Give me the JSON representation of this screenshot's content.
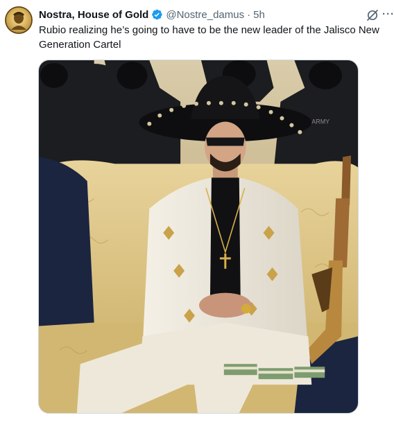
{
  "author": {
    "display_name": "Nostra, House of Gold",
    "handle": "@Nostre_damus",
    "separator": "·",
    "time": "5h",
    "verified": true
  },
  "tweet": {
    "text": "Rubio realizing he’s going to have to be the new leader of the Jalisco New Generation Cartel"
  },
  "media": {
    "type": "image",
    "shirt_label": "ARMY"
  },
  "icons": {
    "verified": "verified-badge-icon",
    "grok": "grok-icon",
    "more": "more-options-icon"
  },
  "colors": {
    "verified_blue": "#1d9bf0",
    "text_primary": "#0f1419",
    "text_secondary": "#536471",
    "border": "#cfd9de"
  }
}
